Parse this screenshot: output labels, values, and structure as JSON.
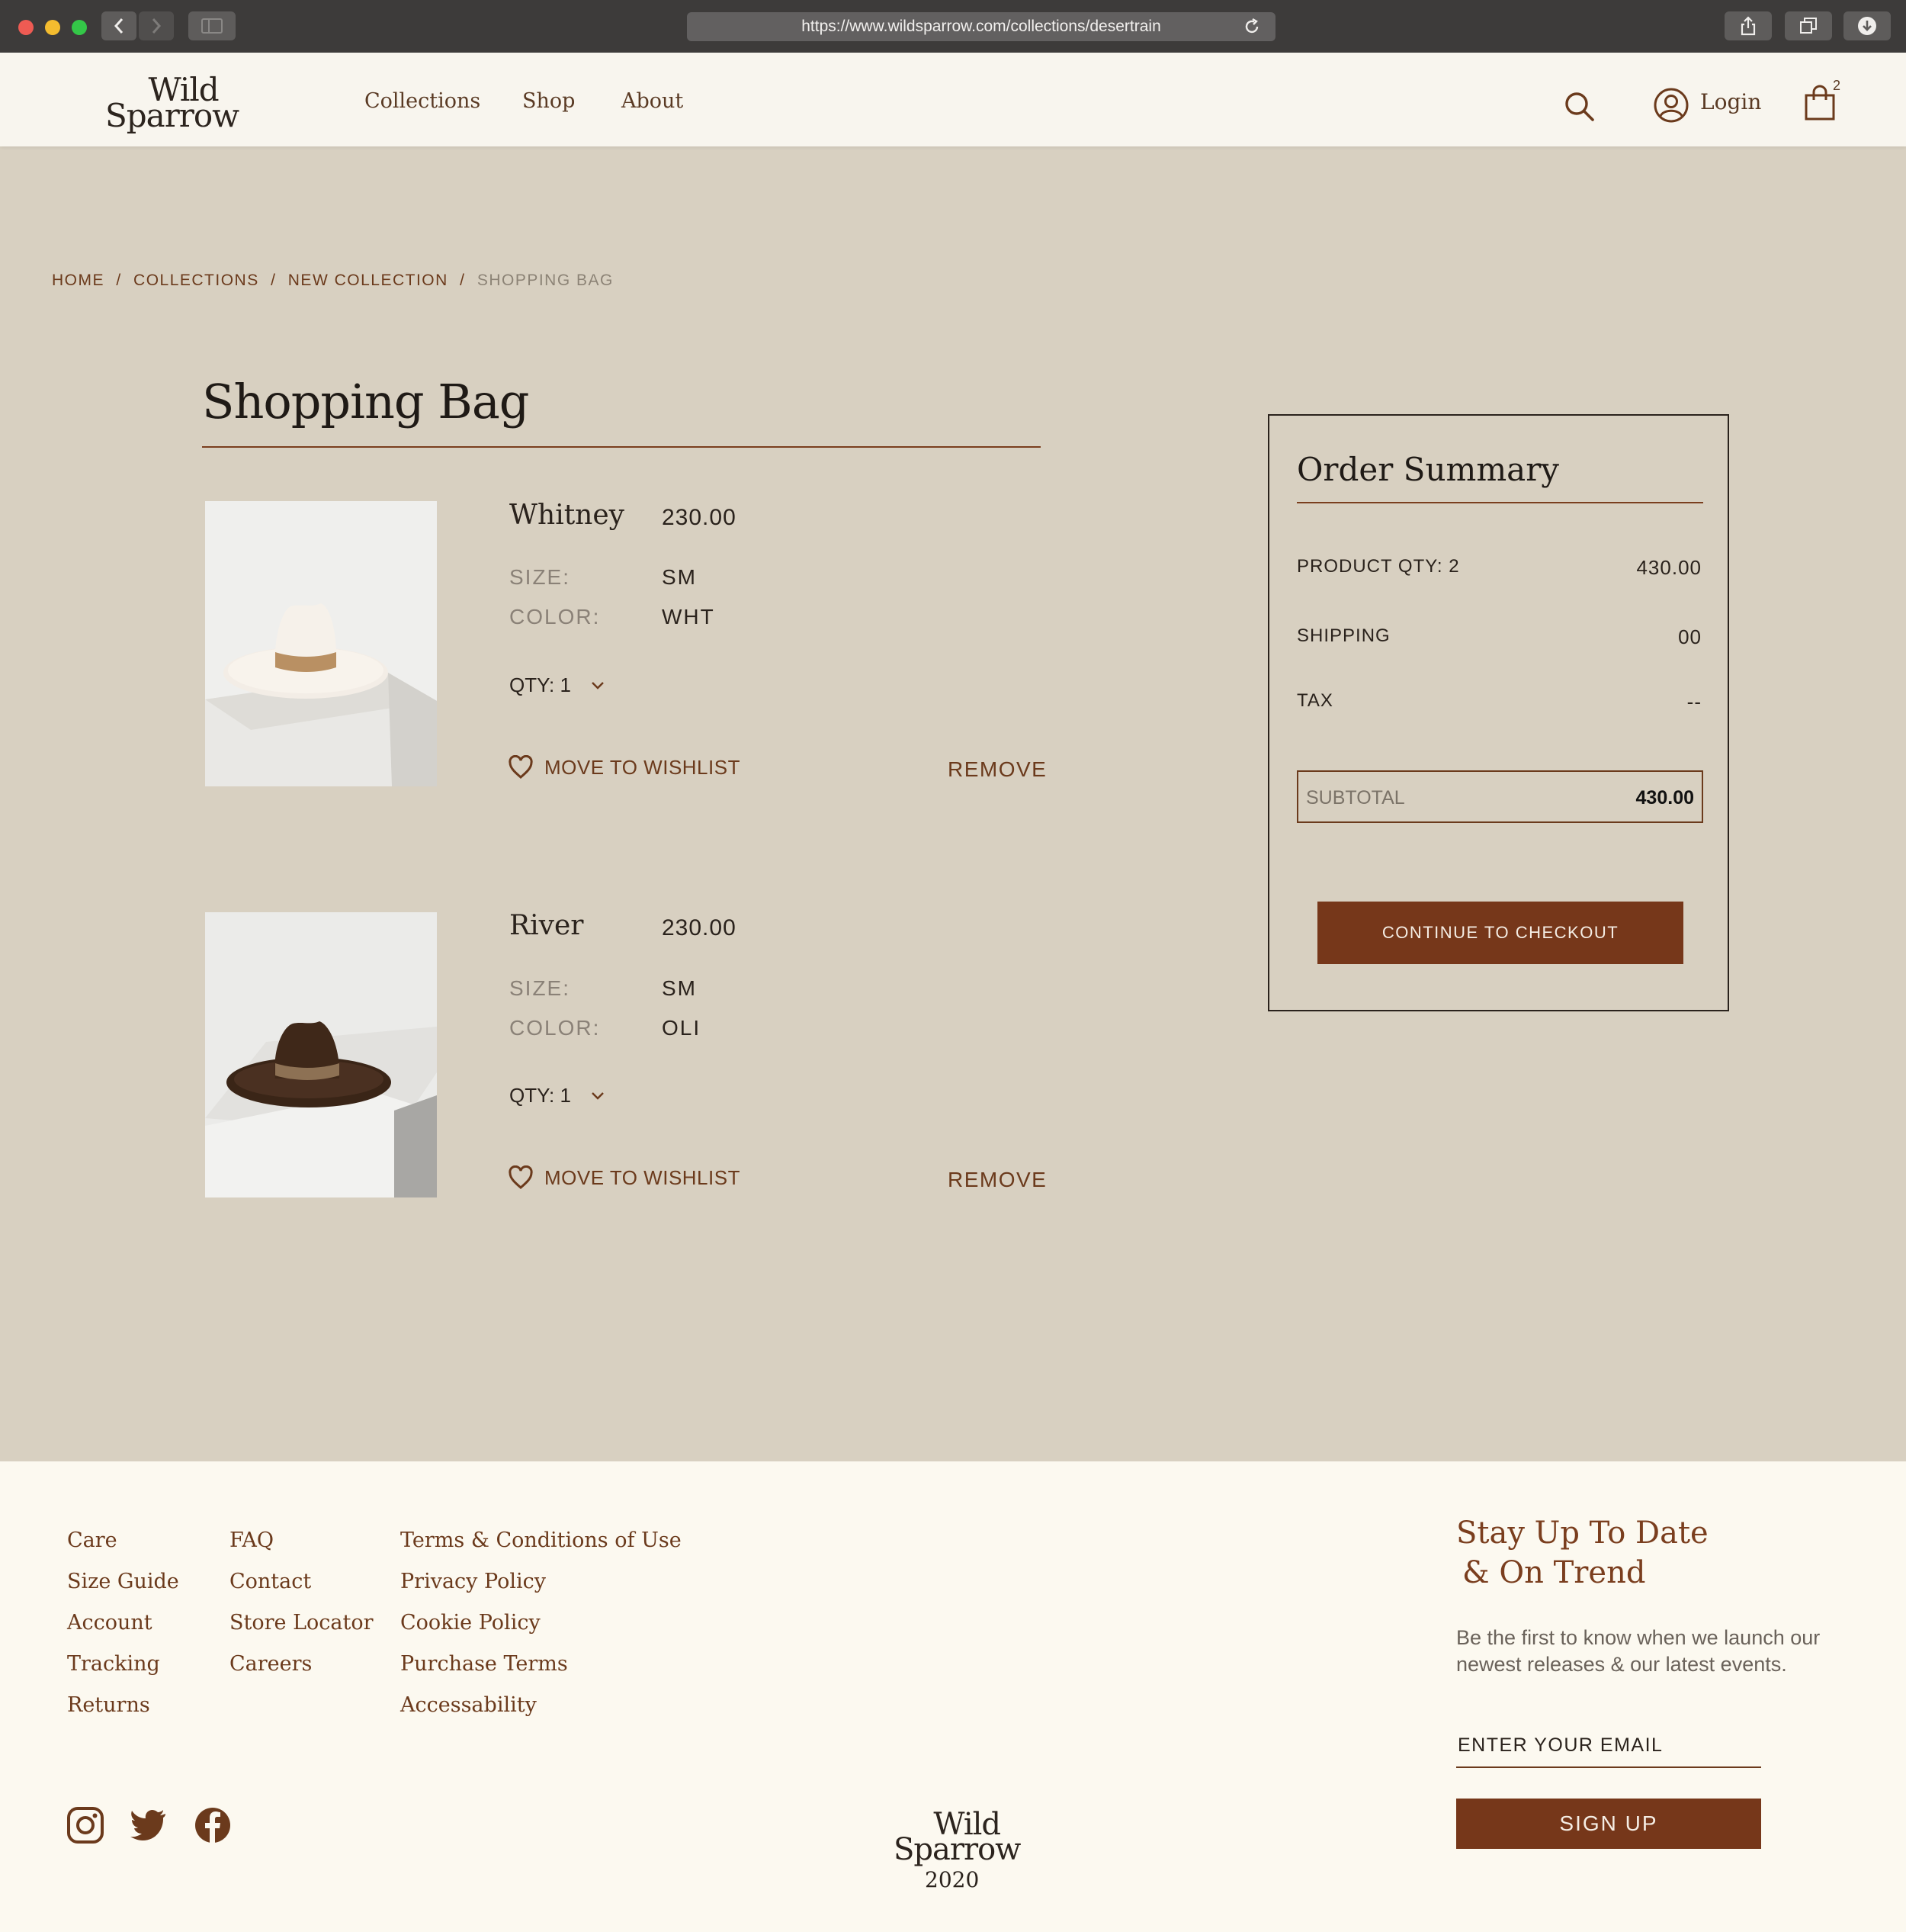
{
  "browser": {
    "url": "https://www.wildsparrow.com/collections/desertrain",
    "traffic_colors": [
      "#ee5b53",
      "#f4bc2f",
      "#34c748"
    ]
  },
  "header": {
    "logo_line1": "Wild",
    "logo_line2": "Sparrow",
    "nav": [
      "Collections",
      "Shop",
      "About"
    ],
    "login_label": "Login",
    "cart_count": "2"
  },
  "breadcrumb": {
    "items": [
      "HOME",
      "COLLECTIONS",
      "NEW COLLECTION"
    ],
    "separator": "/",
    "current": "SHOPPING BAG"
  },
  "bag": {
    "title": "Shopping Bag",
    "size_label": "SIZE:",
    "color_label": "COLOR:",
    "wishlist_label": "MOVE TO WISHLIST",
    "remove_label": "REMOVE",
    "items": [
      {
        "name": "Whitney",
        "price": "230.00",
        "size": "SM",
        "color": "WHT",
        "qty": "QTY: 1"
      },
      {
        "name": "River",
        "price": "230.00",
        "size": "SM",
        "color": "OLI",
        "qty": "QTY: 1"
      }
    ]
  },
  "summary": {
    "title": "Order Summary",
    "rows": [
      {
        "label": "PRODUCT  QTY: 2",
        "value": "430.00"
      },
      {
        "label": "SHIPPING",
        "value": "00"
      },
      {
        "label": "TAX",
        "value": "--"
      }
    ],
    "subtotal_label": "SUBTOTAL",
    "subtotal_value": "430.00",
    "checkout_label": "CONTINUE TO CHECKOUT"
  },
  "footer": {
    "col1": [
      "Care",
      "Size Guide",
      "Account",
      "Tracking",
      "Returns"
    ],
    "col2": [
      "FAQ",
      "Contact",
      "Store Locator",
      "Careers"
    ],
    "col3": [
      "Terms & Conditions of Use",
      "Privacy Policy",
      "Cookie Policy",
      "Purchase Terms",
      "Accessability"
    ],
    "newsletter_title_line1": "Stay Up To Date",
    "newsletter_title_line2": "& On Trend",
    "newsletter_text": "Be the first to know when we launch our newest releases & our latest events.",
    "email_placeholder": "ENTER YOUR EMAIL",
    "signup_label": "SIGN UP",
    "social_icons": [
      "instagram-icon",
      "twitter-icon",
      "facebook-icon"
    ],
    "logo_line1": "Wild",
    "logo_line2": "Sparrow",
    "year": "2020"
  },
  "colors": {
    "accent": "#76371a",
    "page_bg": "#d8d0c1",
    "header_bg": "#f8f5ee",
    "footer_bg": "#fcf9f0"
  }
}
